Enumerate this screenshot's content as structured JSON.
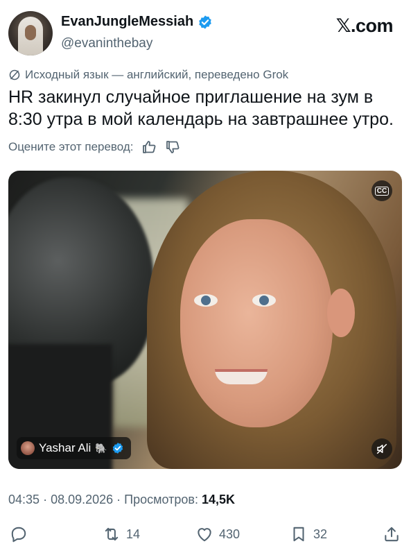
{
  "author": {
    "display_name": "EvanJungleMessiah",
    "handle": "@evaninthebay",
    "verified": true
  },
  "site_brand": "𝕏.com",
  "translation": {
    "notice": "Исходный язык — английский, переведено Grok",
    "rate_prompt": "Оцените этот перевод:"
  },
  "tweet": {
    "text": "HR закинул случайное приглашение на зум в 8:30 утра в мой календарь на завтрашнее утро."
  },
  "media": {
    "cc_label": "CC",
    "source_name": "Yashar Ali",
    "source_emoji": "🐘",
    "source_verified": true
  },
  "meta": {
    "time": "04:35",
    "date": "08.09.2026",
    "views_label": "Просмотров:",
    "views_count": "14,5K"
  },
  "actions": {
    "retweets": "14",
    "likes": "430",
    "bookmarks": "32"
  },
  "colors": {
    "verified_blue": "#1d9bf0",
    "muted_text": "#536471",
    "primary_text": "#0f1419"
  }
}
